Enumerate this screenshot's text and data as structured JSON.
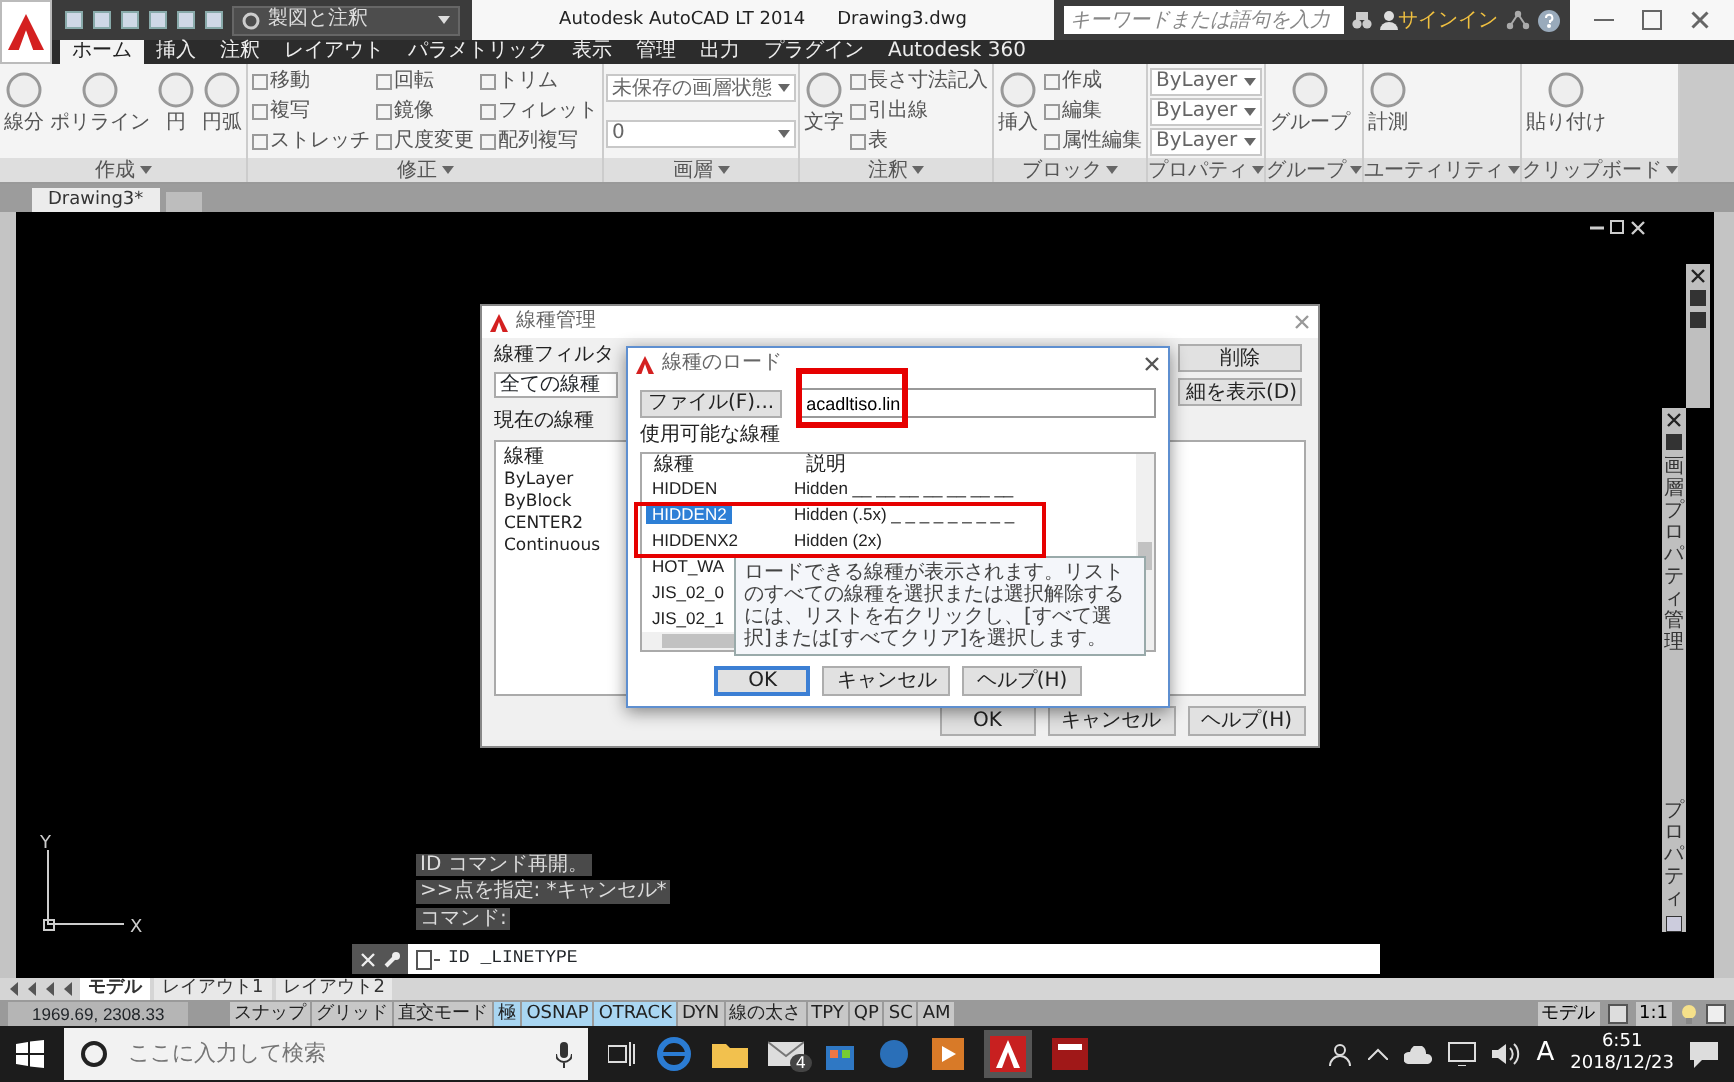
{
  "titlebar": {
    "workspace": "製図と注釈",
    "title": "Autodesk AutoCAD LT 2014",
    "document": "Drawing3.dwg",
    "search": {
      "placeholder": "キーワードまたは語句を入力"
    },
    "signin": "サインイン"
  },
  "ribbon_tabs": [
    {
      "label": "ホーム",
      "selected": true
    },
    {
      "label": "挿入",
      "selected": false
    },
    {
      "label": "注釈",
      "selected": false
    },
    {
      "label": "レイアウト",
      "selected": false
    },
    {
      "label": "パラメトリック",
      "selected": false
    },
    {
      "label": "表示",
      "selected": false
    },
    {
      "label": "管理",
      "selected": false
    },
    {
      "label": "出力",
      "selected": false
    },
    {
      "label": "プラグイン",
      "selected": false
    },
    {
      "label": "Autodesk 360",
      "selected": false
    }
  ],
  "ribbon_panels": [
    {
      "title": "作成",
      "items": [
        {
          "kind": "large",
          "label": "線分"
        },
        {
          "kind": "large",
          "label": "ポリライン"
        },
        {
          "kind": "large",
          "label": "円"
        },
        {
          "kind": "large",
          "label": "円弧"
        }
      ]
    },
    {
      "title": "修正",
      "items": [
        {
          "kind": "small",
          "label": "移動"
        },
        {
          "kind": "small",
          "label": "複写"
        },
        {
          "kind": "small",
          "label": "ストレッチ"
        },
        {
          "kind": "small",
          "label": "回転"
        },
        {
          "kind": "small",
          "label": "鏡像"
        },
        {
          "kind": "small",
          "label": "尺度変更"
        },
        {
          "kind": "small",
          "label": "トリム"
        },
        {
          "kind": "small",
          "label": "フィレット"
        },
        {
          "kind": "small",
          "label": "配列複写"
        }
      ]
    },
    {
      "title": "画層",
      "items": [
        {
          "kind": "dropdown",
          "label": "未保存の画層状態"
        },
        {
          "kind": "dropdown",
          "label": "0"
        }
      ]
    },
    {
      "title": "注釈",
      "items": [
        {
          "kind": "large",
          "label": "文字"
        },
        {
          "kind": "small",
          "label": "長さ寸法記入"
        },
        {
          "kind": "small",
          "label": "引出線"
        },
        {
          "kind": "small",
          "label": "表"
        }
      ]
    },
    {
      "title": "ブロック",
      "items": [
        {
          "kind": "large",
          "label": "挿入"
        },
        {
          "kind": "small",
          "label": "作成"
        },
        {
          "kind": "small",
          "label": "編集"
        },
        {
          "kind": "small",
          "label": "属性編集"
        }
      ]
    },
    {
      "title": "プロパティ",
      "items": [
        {
          "kind": "dropdown",
          "label": "ByLayer"
        },
        {
          "kind": "dropdown",
          "label": "ByLayer"
        },
        {
          "kind": "dropdown",
          "label": "ByLayer"
        }
      ]
    },
    {
      "title": "グループ",
      "items": [
        {
          "kind": "large",
          "label": "グループ"
        }
      ]
    },
    {
      "title": "ユーティリティ",
      "items": [
        {
          "kind": "large",
          "label": "計測"
        }
      ]
    },
    {
      "title": "クリップボード",
      "items": [
        {
          "kind": "large",
          "label": "貼り付け"
        }
      ]
    }
  ],
  "file_tabs": [
    {
      "label": "Drawing3*",
      "selected": true
    }
  ],
  "linetype_manager": {
    "title": "線種管理",
    "filter_label": "線種フィルタ",
    "filter_value": "全ての線種",
    "side_buttons": [
      "削除",
      "細を表示(D)"
    ],
    "current_label": "現在の線種",
    "list_header": "線種",
    "items": [
      "ByLayer",
      "ByBlock",
      "CENTER2",
      "Continuous"
    ],
    "buttons": [
      "OK",
      "キャンセル",
      "ヘルプ(H)"
    ]
  },
  "load_dialog": {
    "title": "線種のロード",
    "file_button": "ファイル(F)...",
    "file_value": "acadltiso.lin",
    "list_label": "使用可能な線種",
    "columns": [
      "線種",
      "説明"
    ],
    "rows": [
      {
        "name": "HIDDEN",
        "description": "Hidden __ __ __ __ __ __ __",
        "selected": false
      },
      {
        "name": "HIDDEN2",
        "description": "Hidden (.5x) _ _ _ _ _ _ _ _ _",
        "selected": true
      },
      {
        "name": "HIDDENX2",
        "description": "Hidden (2x)",
        "selected": false
      },
      {
        "name": "HOT_WA",
        "selected": false
      },
      {
        "name": "JIS_02_0",
        "selected": false
      },
      {
        "name": "JIS_02_1",
        "selected": false
      }
    ],
    "tooltip": "ロードできる線種が表示されます。リストのすべての線種を選択または選択解除するには、リストを右クリックし、[すべて選択]または[すべてクリア]を選択します。",
    "buttons": [
      "OK",
      "キャンセル",
      "ヘルプ(H)"
    ]
  },
  "palettes": [
    {
      "title": "画層プロパティ管理"
    },
    {
      "title": "プロパティ"
    }
  ],
  "ucs": {
    "x_label": "X",
    "y_label": "Y"
  },
  "command_history": [
    "ID コマンド再開。",
    ">>点を指定: *キャンセル*",
    "コマンド:"
  ],
  "command_line": {
    "value": "ID _LINETYPE"
  },
  "layout_tabs": [
    {
      "label": "モデル",
      "selected": true
    },
    {
      "label": "レイアウト1",
      "selected": false
    },
    {
      "label": "レイアウト2",
      "selected": false
    }
  ],
  "status_bar": {
    "coordinates": "1969.69, 2308.33",
    "toggles": [
      {
        "label": "スナップ",
        "on": false
      },
      {
        "label": "グリッド",
        "on": false
      },
      {
        "label": "直交モード",
        "on": false
      },
      {
        "label": "極",
        "on": true
      },
      {
        "label": "OSNAP",
        "on": true
      },
      {
        "label": "OTRACK",
        "on": true
      },
      {
        "label": "DYN",
        "on": false
      },
      {
        "label": "線の太さ",
        "on": false
      },
      {
        "label": "TPY",
        "on": false
      },
      {
        "label": "QP",
        "on": false
      },
      {
        "label": "SC",
        "on": false
      },
      {
        "label": "AM",
        "on": false
      }
    ],
    "model_label": "モデル",
    "scale": "1:1"
  },
  "taskbar": {
    "search": {
      "placeholder": "ここに入力して検索"
    },
    "mail_badge": "4",
    "ime": "A",
    "time": "6:51",
    "date": "2018/12/23"
  }
}
